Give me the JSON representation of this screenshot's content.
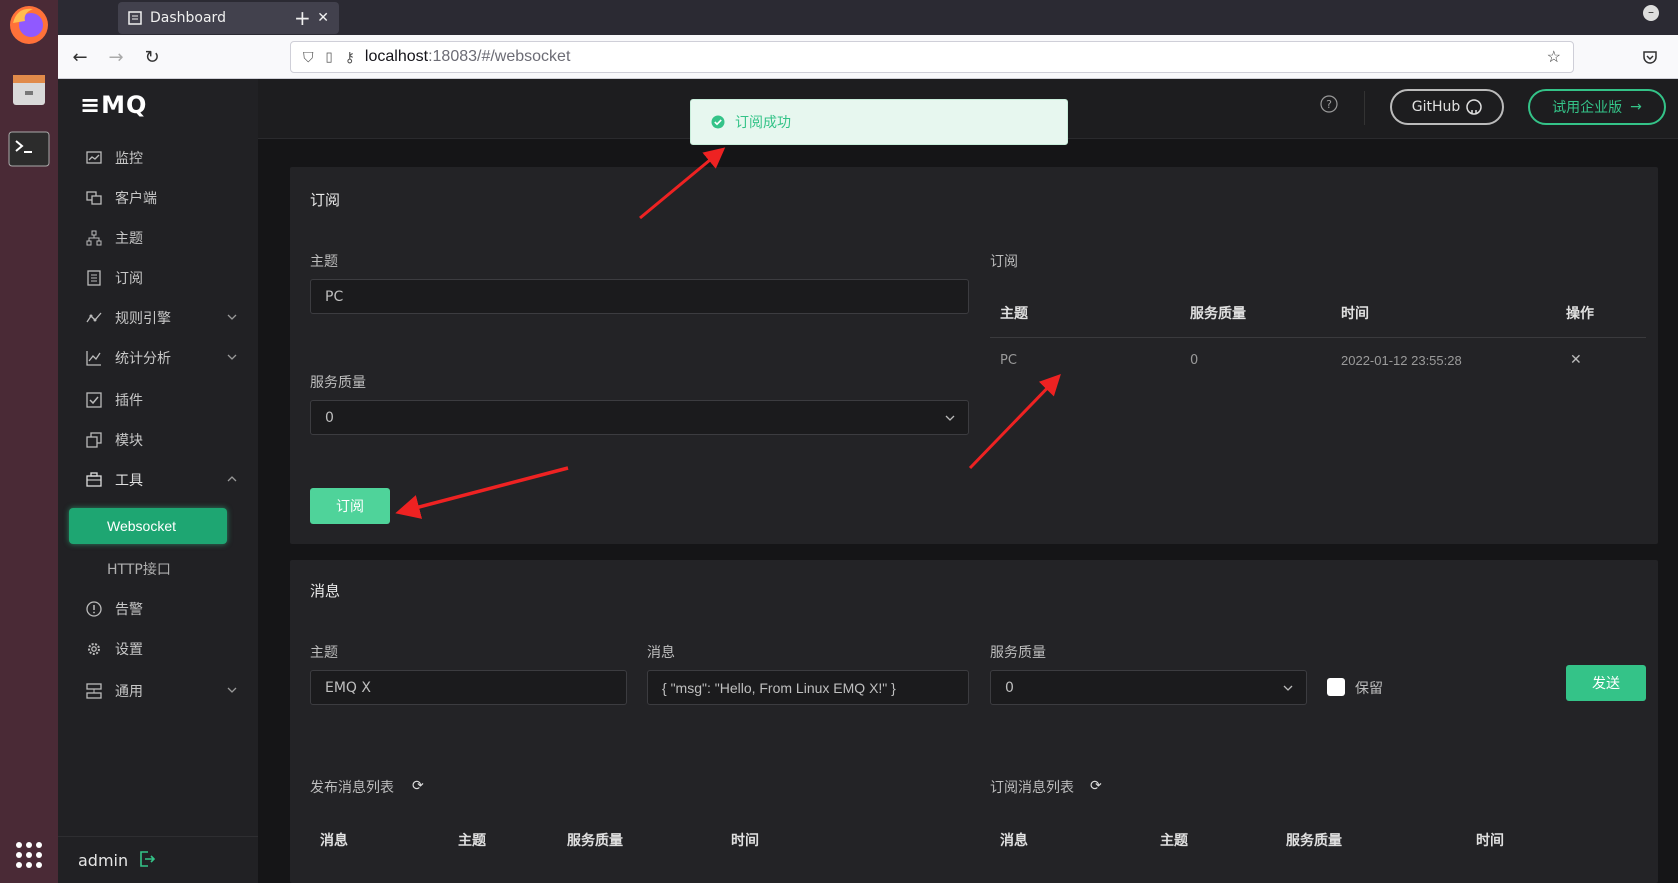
{
  "browser": {
    "tab_title": "Dashboard",
    "url_host": "localhost",
    "url_rest": ":18083/#/websocket"
  },
  "app": {
    "logo": "≡MQ",
    "user": "admin",
    "github_label": "GitHub",
    "enterprise_label": "试用企业版"
  },
  "sidebar": {
    "items": [
      {
        "label": "监控",
        "icon": "monitor-icon"
      },
      {
        "label": "客户端",
        "icon": "clients-icon"
      },
      {
        "label": "主题",
        "icon": "topics-icon"
      },
      {
        "label": "订阅",
        "icon": "subscriptions-icon"
      },
      {
        "label": "规则引擎",
        "icon": "rules-icon"
      },
      {
        "label": "统计分析",
        "icon": "stats-icon"
      },
      {
        "label": "插件",
        "icon": "plugins-icon"
      },
      {
        "label": "模块",
        "icon": "modules-icon"
      },
      {
        "label": "工具",
        "icon": "tools-icon"
      },
      {
        "label": "Websocket"
      },
      {
        "label": "HTTP接口"
      },
      {
        "label": "告警",
        "icon": "alarm-icon"
      },
      {
        "label": "设置",
        "icon": "settings-icon"
      },
      {
        "label": "通用",
        "icon": "general-icon"
      }
    ]
  },
  "toast": {
    "text": "订阅成功"
  },
  "subscribe": {
    "title": "订阅",
    "topic_label": "主题",
    "topic_value": "PC",
    "qos_label": "服务质量",
    "qos_value": "0",
    "button": "订阅",
    "list_title": "订阅",
    "columns": [
      "主题",
      "服务质量",
      "时间",
      "操作"
    ],
    "rows": [
      {
        "topic": "PC",
        "qos": "0",
        "time": "2022-01-12 23:55:28"
      }
    ]
  },
  "message": {
    "title": "消息",
    "topic_label": "主题",
    "topic_value": "EMQ X",
    "msg_label": "消息",
    "msg_value": "{ \"msg\": \"Hello, From Linux EMQ X!\" }",
    "qos_label": "服务质量",
    "qos_value": "0",
    "retain_label": "保留",
    "send_button": "发送",
    "pub_list_title": "发布消息列表",
    "pub_columns": [
      "消息",
      "主题",
      "服务质量",
      "时间"
    ],
    "sub_list_title": "订阅消息列表",
    "sub_columns": [
      "消息",
      "主题",
      "服务质量",
      "时间"
    ]
  }
}
